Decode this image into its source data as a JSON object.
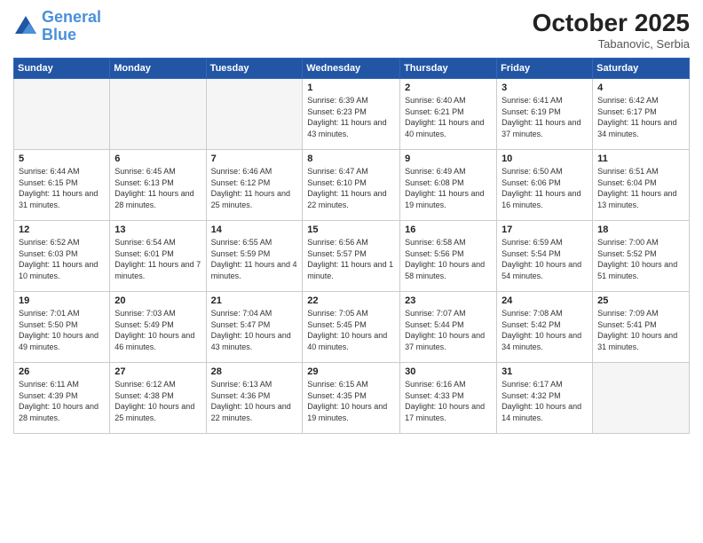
{
  "header": {
    "logo_line1": "General",
    "logo_line2": "Blue",
    "month": "October 2025",
    "location": "Tabanovic, Serbia"
  },
  "days_of_week": [
    "Sunday",
    "Monday",
    "Tuesday",
    "Wednesday",
    "Thursday",
    "Friday",
    "Saturday"
  ],
  "weeks": [
    [
      {
        "day": "",
        "info": ""
      },
      {
        "day": "",
        "info": ""
      },
      {
        "day": "",
        "info": ""
      },
      {
        "day": "1",
        "info": "Sunrise: 6:39 AM\nSunset: 6:23 PM\nDaylight: 11 hours and 43 minutes."
      },
      {
        "day": "2",
        "info": "Sunrise: 6:40 AM\nSunset: 6:21 PM\nDaylight: 11 hours and 40 minutes."
      },
      {
        "day": "3",
        "info": "Sunrise: 6:41 AM\nSunset: 6:19 PM\nDaylight: 11 hours and 37 minutes."
      },
      {
        "day": "4",
        "info": "Sunrise: 6:42 AM\nSunset: 6:17 PM\nDaylight: 11 hours and 34 minutes."
      }
    ],
    [
      {
        "day": "5",
        "info": "Sunrise: 6:44 AM\nSunset: 6:15 PM\nDaylight: 11 hours and 31 minutes."
      },
      {
        "day": "6",
        "info": "Sunrise: 6:45 AM\nSunset: 6:13 PM\nDaylight: 11 hours and 28 minutes."
      },
      {
        "day": "7",
        "info": "Sunrise: 6:46 AM\nSunset: 6:12 PM\nDaylight: 11 hours and 25 minutes."
      },
      {
        "day": "8",
        "info": "Sunrise: 6:47 AM\nSunset: 6:10 PM\nDaylight: 11 hours and 22 minutes."
      },
      {
        "day": "9",
        "info": "Sunrise: 6:49 AM\nSunset: 6:08 PM\nDaylight: 11 hours and 19 minutes."
      },
      {
        "day": "10",
        "info": "Sunrise: 6:50 AM\nSunset: 6:06 PM\nDaylight: 11 hours and 16 minutes."
      },
      {
        "day": "11",
        "info": "Sunrise: 6:51 AM\nSunset: 6:04 PM\nDaylight: 11 hours and 13 minutes."
      }
    ],
    [
      {
        "day": "12",
        "info": "Sunrise: 6:52 AM\nSunset: 6:03 PM\nDaylight: 11 hours and 10 minutes."
      },
      {
        "day": "13",
        "info": "Sunrise: 6:54 AM\nSunset: 6:01 PM\nDaylight: 11 hours and 7 minutes."
      },
      {
        "day": "14",
        "info": "Sunrise: 6:55 AM\nSunset: 5:59 PM\nDaylight: 11 hours and 4 minutes."
      },
      {
        "day": "15",
        "info": "Sunrise: 6:56 AM\nSunset: 5:57 PM\nDaylight: 11 hours and 1 minute."
      },
      {
        "day": "16",
        "info": "Sunrise: 6:58 AM\nSunset: 5:56 PM\nDaylight: 10 hours and 58 minutes."
      },
      {
        "day": "17",
        "info": "Sunrise: 6:59 AM\nSunset: 5:54 PM\nDaylight: 10 hours and 54 minutes."
      },
      {
        "day": "18",
        "info": "Sunrise: 7:00 AM\nSunset: 5:52 PM\nDaylight: 10 hours and 51 minutes."
      }
    ],
    [
      {
        "day": "19",
        "info": "Sunrise: 7:01 AM\nSunset: 5:50 PM\nDaylight: 10 hours and 49 minutes."
      },
      {
        "day": "20",
        "info": "Sunrise: 7:03 AM\nSunset: 5:49 PM\nDaylight: 10 hours and 46 minutes."
      },
      {
        "day": "21",
        "info": "Sunrise: 7:04 AM\nSunset: 5:47 PM\nDaylight: 10 hours and 43 minutes."
      },
      {
        "day": "22",
        "info": "Sunrise: 7:05 AM\nSunset: 5:45 PM\nDaylight: 10 hours and 40 minutes."
      },
      {
        "day": "23",
        "info": "Sunrise: 7:07 AM\nSunset: 5:44 PM\nDaylight: 10 hours and 37 minutes."
      },
      {
        "day": "24",
        "info": "Sunrise: 7:08 AM\nSunset: 5:42 PM\nDaylight: 10 hours and 34 minutes."
      },
      {
        "day": "25",
        "info": "Sunrise: 7:09 AM\nSunset: 5:41 PM\nDaylight: 10 hours and 31 minutes."
      }
    ],
    [
      {
        "day": "26",
        "info": "Sunrise: 6:11 AM\nSunset: 4:39 PM\nDaylight: 10 hours and 28 minutes."
      },
      {
        "day": "27",
        "info": "Sunrise: 6:12 AM\nSunset: 4:38 PM\nDaylight: 10 hours and 25 minutes."
      },
      {
        "day": "28",
        "info": "Sunrise: 6:13 AM\nSunset: 4:36 PM\nDaylight: 10 hours and 22 minutes."
      },
      {
        "day": "29",
        "info": "Sunrise: 6:15 AM\nSunset: 4:35 PM\nDaylight: 10 hours and 19 minutes."
      },
      {
        "day": "30",
        "info": "Sunrise: 6:16 AM\nSunset: 4:33 PM\nDaylight: 10 hours and 17 minutes."
      },
      {
        "day": "31",
        "info": "Sunrise: 6:17 AM\nSunset: 4:32 PM\nDaylight: 10 hours and 14 minutes."
      },
      {
        "day": "",
        "info": ""
      }
    ]
  ]
}
